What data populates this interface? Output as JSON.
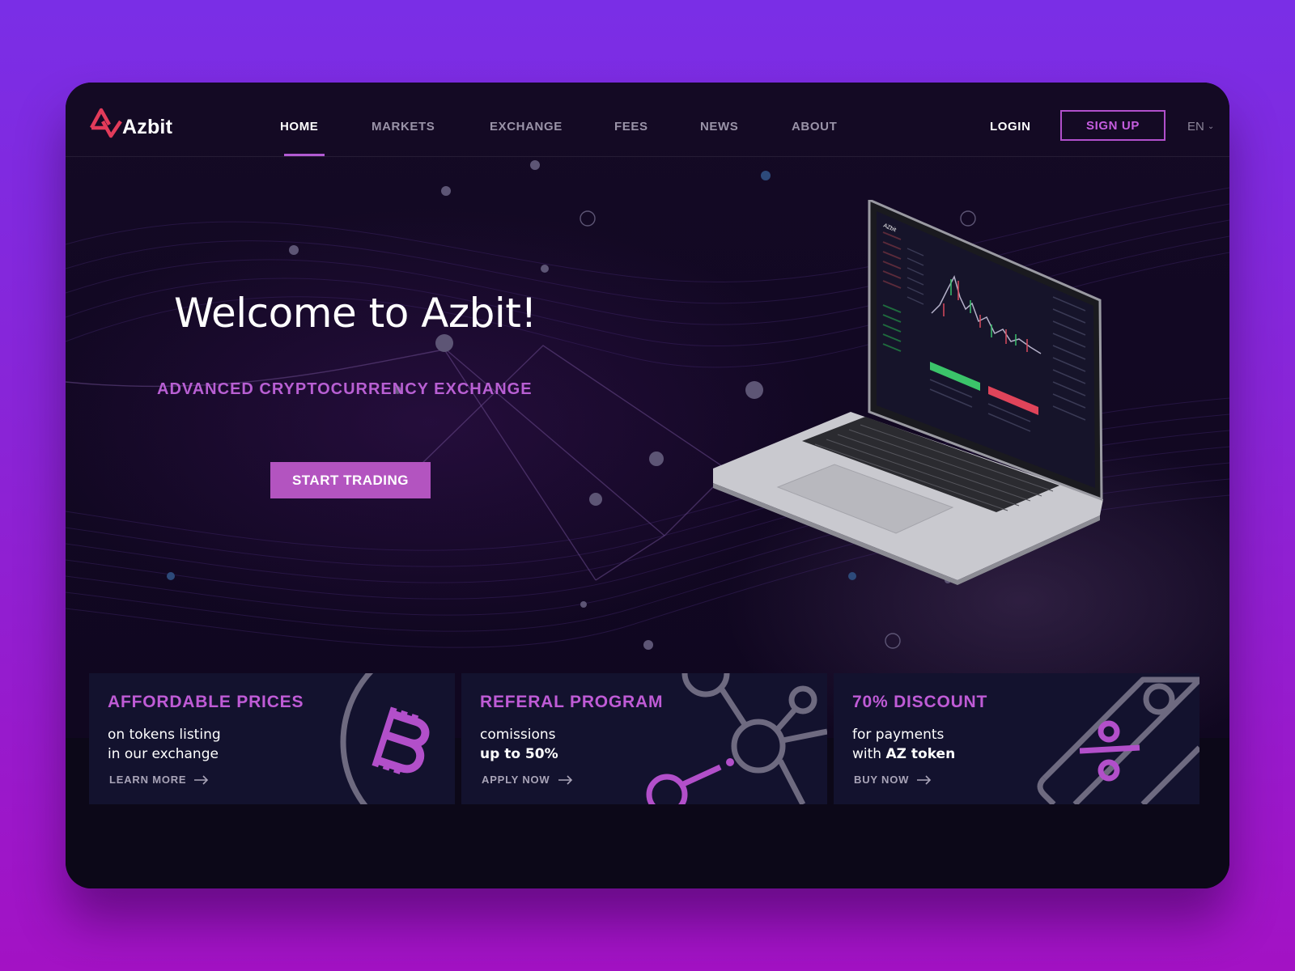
{
  "brand": {
    "name": "Azbit",
    "logo_icon": "azbit-logo-icon",
    "accent": "#b354c0",
    "logo_red": "#e23b5a"
  },
  "nav": {
    "items": [
      {
        "label": "HOME",
        "active": true
      },
      {
        "label": "MARKETS",
        "active": false
      },
      {
        "label": "EXCHANGE",
        "active": false
      },
      {
        "label": "FEES",
        "active": false
      },
      {
        "label": "NEWS",
        "active": false
      },
      {
        "label": "ABOUT",
        "active": false
      }
    ],
    "login": "LOGIN",
    "signup": "SIGN UP",
    "language": "EN"
  },
  "hero": {
    "title": "Welcome to Azbit!",
    "subtitle": "ADVANCED CRYPTOCURRENCY EXCHANGE",
    "cta": "START TRADING",
    "laptop_brand": "AZbit"
  },
  "cards": [
    {
      "title": "AFFORDABLE PRICES",
      "line1": "on tokens listing",
      "line2": "in our exchange",
      "link": "LEARN MORE",
      "icon": "bitcoin-icon"
    },
    {
      "title": "REFERAL PROGRAM",
      "line1": "comissions",
      "line2": "up to 50%",
      "link": "APPLY NOW",
      "icon": "network-nodes-icon"
    },
    {
      "title": "70% DISCOUNT",
      "line1": "for payments",
      "line2_prefix": "with ",
      "line2_bold": "AZ token",
      "link": "BUY NOW",
      "icon": "percent-card-icon"
    }
  ]
}
